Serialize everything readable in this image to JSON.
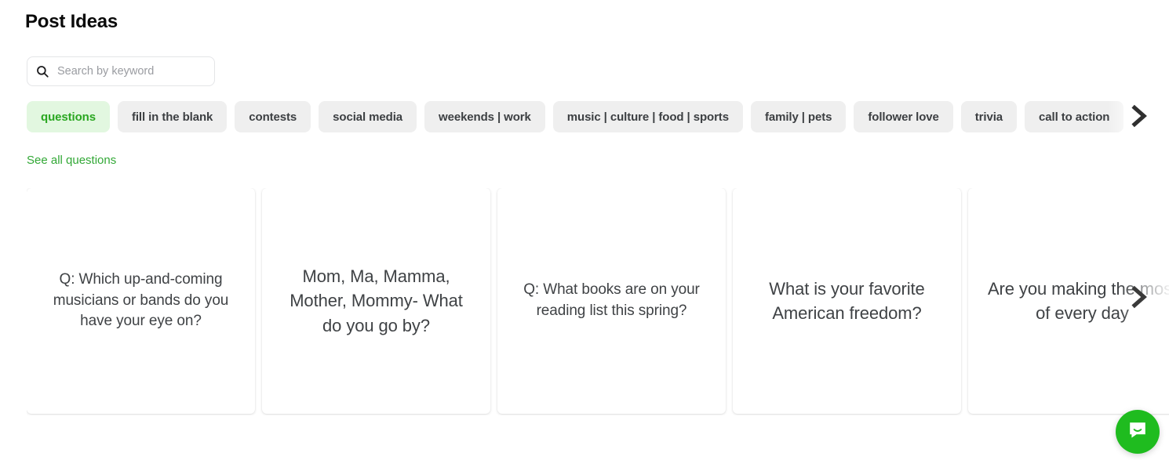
{
  "page": {
    "title": "Post Ideas"
  },
  "search": {
    "placeholder": "Search by keyword",
    "value": "",
    "icon": "search-icon"
  },
  "filters": {
    "chips": [
      {
        "label": "questions",
        "selected": true
      },
      {
        "label": "fill in the blank",
        "selected": false
      },
      {
        "label": "contests",
        "selected": false
      },
      {
        "label": "social media",
        "selected": false
      },
      {
        "label": "weekends | work",
        "selected": false
      },
      {
        "label": "music | culture | food | sports",
        "selected": false
      },
      {
        "label": "family | pets",
        "selected": false
      },
      {
        "label": "follower love",
        "selected": false
      },
      {
        "label": "trivia",
        "selected": false
      },
      {
        "label": "call to action",
        "selected": false
      }
    ],
    "next_icon": "chevron-right-icon",
    "selected_color": "#2aa721",
    "selected_bg": "#e2f7e0",
    "chip_bg": "#efefef"
  },
  "see_all": {
    "label": "See all questions",
    "color": "#32a836"
  },
  "cards": {
    "next_icon": "chevron-right-icon",
    "items": [
      {
        "text": "Q: Which up-and-coming musicians or bands do you have your eye on?",
        "size": "normal"
      },
      {
        "text": "Mom, Ma, Mamma, Mother, Mommy- What do you go by?",
        "size": "large"
      },
      {
        "text": "Q: What books are on your reading list this spring?",
        "size": "normal"
      },
      {
        "text": "What is your favorite American freedom?",
        "size": "large"
      },
      {
        "text": "Are you making the most of every day",
        "size": "large"
      }
    ]
  },
  "chat": {
    "icon": "chat-bubble-icon",
    "color": "#1fbc1f"
  }
}
